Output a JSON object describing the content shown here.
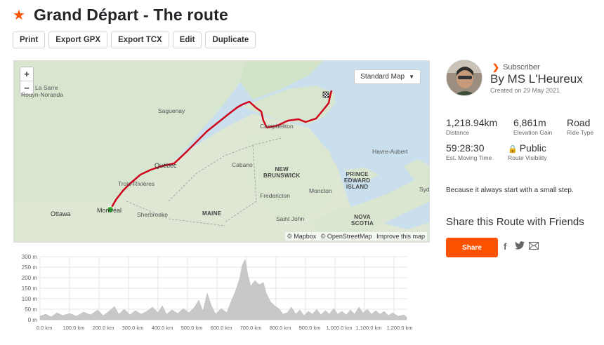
{
  "page": {
    "title": "Grand Départ - The route",
    "star_icon": "star-icon"
  },
  "toolbar": {
    "print": "Print",
    "export_gpx": "Export GPX",
    "export_tcx": "Export TCX",
    "edit": "Edit",
    "duplicate": "Duplicate"
  },
  "map": {
    "zoom_in": "+",
    "zoom_out": "−",
    "style_label": "Standard Map",
    "attribution": [
      "© Mapbox",
      "© OpenStreetMap",
      "Improve this map"
    ],
    "labels": {
      "lasarre": "La Sarre",
      "ouyn": "Rouyn-Noranda",
      "saguenay": "Saguenay",
      "campbellton": "Campbellton",
      "havre_aubert": "Havre-Aubert",
      "quebec": "Québec",
      "cabano": "Cabano",
      "new_brunswick": "NEW\nBRUNSWICK",
      "pei": "PRINCE\nEDWARD\nISLAND",
      "trois_rivieres": "Trois-Rivières",
      "moncton": "Moncton",
      "fredericton": "Fredericton",
      "sydney": "Syd",
      "ottawa": "Ottawa",
      "montreal": "Montréal",
      "sherbrooke": "Sherbrooke",
      "maine": "MAINE",
      "saint_john": "Saint John",
      "nova_scotia": "NOVA\nSCOTIA"
    },
    "route_color": "#d0021b",
    "start_color": "#2eb82e"
  },
  "elevation": {
    "y_labels": [
      "300 m",
      "250 m",
      "200 m",
      "150 m",
      "100 m",
      "50 m",
      "0 m"
    ],
    "x_labels": [
      "0.0 km",
      "100.0 km",
      "200.0 km",
      "300.0 km",
      "400.0 km",
      "500.0 km",
      "600.0 km",
      "700.0 km",
      "800.0 km",
      "900.0 km",
      "1,000.0 km",
      "1,100.0 km",
      "1,200.0 km"
    ]
  },
  "athlete": {
    "badge": "Subscriber",
    "name": "By MS L'Heureux",
    "created": "Created on 29 May 2021"
  },
  "stats": {
    "distance": {
      "value": "1,218.94km",
      "label": "Distance"
    },
    "elevation": {
      "value": "6,861m",
      "label": "Elevation Gain"
    },
    "type": {
      "value": "Road",
      "label": "Ride Type"
    },
    "time": {
      "value": "59:28:30",
      "label": "Est. Moving Time"
    },
    "visibility": {
      "value": "Public",
      "label": "Route Visibility"
    }
  },
  "description": "Because it always start with a small step.",
  "share": {
    "title": "Share this Route with Friends",
    "button": "Share",
    "icons": [
      "facebook-icon",
      "twitter-icon",
      "email-icon"
    ]
  },
  "colors": {
    "accent": "#fc5200"
  }
}
